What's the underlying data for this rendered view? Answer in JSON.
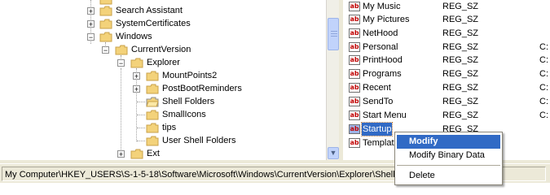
{
  "tree": {
    "items": [
      {
        "label": "",
        "partial": true
      },
      {
        "label": "Search Assistant"
      },
      {
        "label": "SystemCertificates"
      },
      {
        "label": "Windows"
      },
      {
        "label": "CurrentVersion"
      },
      {
        "label": "Explorer"
      },
      {
        "label": "MountPoints2"
      },
      {
        "label": "PostBootReminders"
      },
      {
        "label": "Shell Folders"
      },
      {
        "label": "SmallIcons"
      },
      {
        "label": "tips"
      },
      {
        "label": "User Shell Folders"
      },
      {
        "label": "Ext"
      }
    ]
  },
  "list": {
    "rows": [
      {
        "name": "My Music",
        "type": "REG_SZ",
        "data": ""
      },
      {
        "name": "My Pictures",
        "type": "REG_SZ",
        "data": ""
      },
      {
        "name": "NetHood",
        "type": "REG_SZ",
        "data": ""
      },
      {
        "name": "Personal",
        "type": "REG_SZ",
        "data": "C:"
      },
      {
        "name": "PrintHood",
        "type": "REG_SZ",
        "data": "C:"
      },
      {
        "name": "Programs",
        "type": "REG_SZ",
        "data": "C:"
      },
      {
        "name": "Recent",
        "type": "REG_SZ",
        "data": "C:"
      },
      {
        "name": "SendTo",
        "type": "REG_SZ",
        "data": "C:"
      },
      {
        "name": "Start Menu",
        "type": "REG_SZ",
        "data": "C:"
      },
      {
        "name": "Startup",
        "type": "REG_SZ",
        "data": ""
      },
      {
        "name": "Templat",
        "type": "",
        "data": ""
      }
    ],
    "icon_glyph": "ab"
  },
  "context_menu": {
    "items": [
      "Modify",
      "Modify Binary Data",
      "Delete"
    ]
  },
  "status": {
    "path": "My Computer\\HKEY_USERS\\S-1-5-18\\Software\\Microsoft\\Windows\\CurrentVersion\\Explorer\\Shell Fo"
  },
  "colors": {
    "selection": "#316ac5",
    "folder": "#f3d27a",
    "chrome": "#ece9d8"
  }
}
